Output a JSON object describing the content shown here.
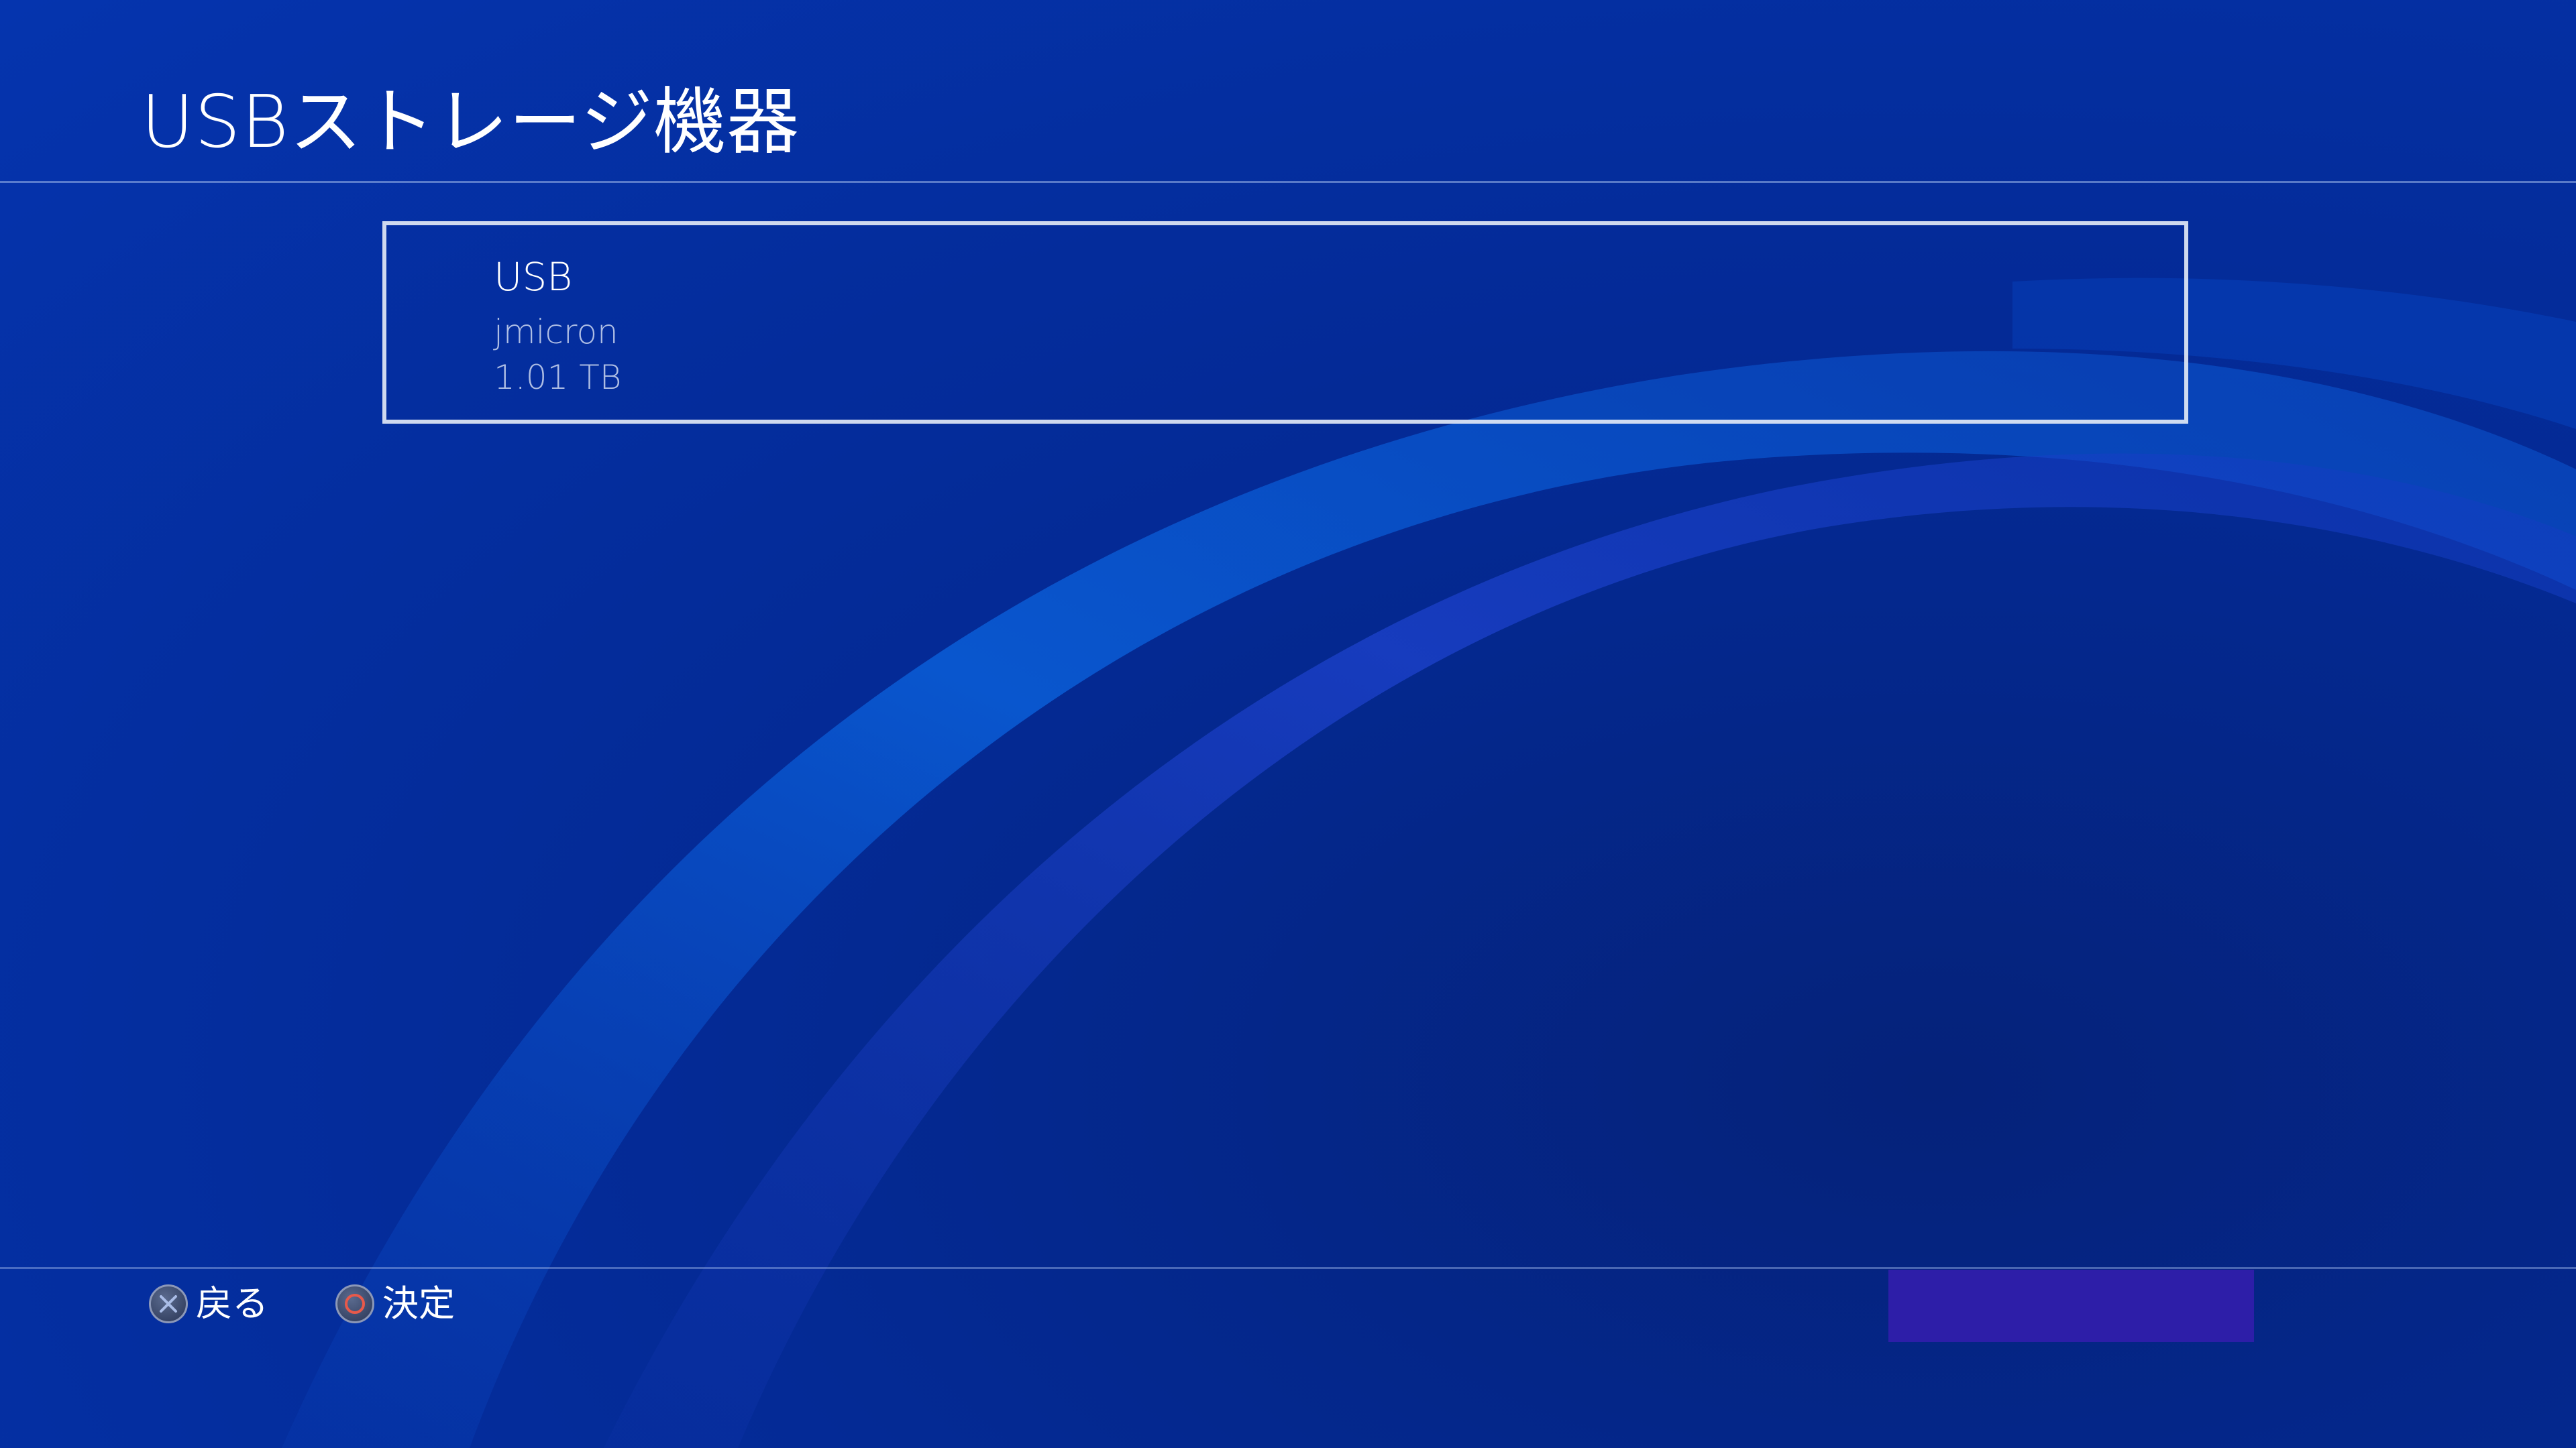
{
  "header": {
    "title": "USBストレージ機器"
  },
  "devices": [
    {
      "name": "USB",
      "vendor": "jmicron",
      "capacity": "1.01 TB",
      "selected": true
    }
  ],
  "footer": {
    "back": {
      "icon": "cross-button-icon",
      "label": "戻る",
      "color": "#8fa6d6"
    },
    "confirm": {
      "icon": "circle-button-icon",
      "label": "決定",
      "color": "#e8594a"
    }
  },
  "colors": {
    "background": "#0534ae",
    "focus_border": "#e1e8f5",
    "accent_panel": "#2d1ea8"
  }
}
